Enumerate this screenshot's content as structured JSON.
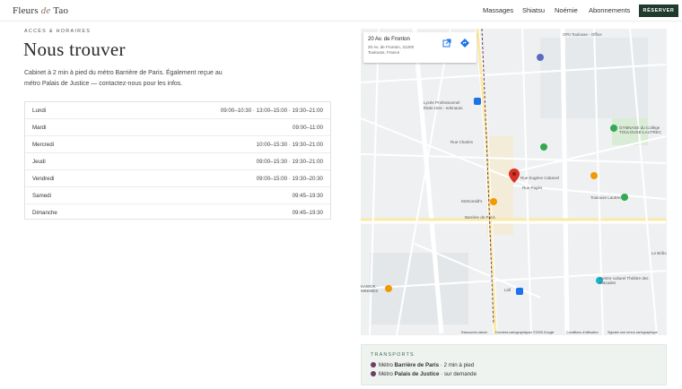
{
  "header": {
    "logo_part1": "Fleurs ",
    "logo_part2": "de",
    "logo_part3": " Tao",
    "nav": [
      "Massages",
      "Shiatsu",
      "Noémie",
      "Abonnements"
    ],
    "cta": "RÉSERVER"
  },
  "section": {
    "eyebrow": "ACCÈS & HORAIRES",
    "title": "Nous trouver",
    "intro": "Cabinet à 2 min à pied du métro Barrière de Paris. Également reçue au métro Palais de Justice — contactez-nous pour les infos."
  },
  "hours": [
    {
      "day": "Lundi",
      "time": "09:00–10:30 · 13:00–15:00 · 19:30–21:00"
    },
    {
      "day": "Mardi",
      "time": "09:00–11:00"
    },
    {
      "day": "Mercredi",
      "time": "10:00–15:30 · 19:30–21:00"
    },
    {
      "day": "Jeudi",
      "time": "09:00–15:30 · 19:30–21:00"
    },
    {
      "day": "Vendredi",
      "time": "09:00–15:00 · 19:30–20:30"
    },
    {
      "day": "Samedi",
      "time": "09:45–19:30"
    },
    {
      "day": "Dimanche",
      "time": "09:45–19:30"
    }
  ],
  "map": {
    "card_title": "20 Av. de Fronton",
    "card_address": "20 Av. de Fronton, 31200 Toulouse, France",
    "labels": {
      "ofii": "OFII Toulouse - Office",
      "lycee": "Lycée Professionnel",
      "lycee2": "Toulouse-Lautrec",
      "gymnase": "GYMNASE du Collège TOULOUSE-LAUTREC",
      "institut": "Institut Toulouse",
      "etats": "États-Unis - edenauto",
      "rue_charles": "Rue Charles",
      "rue_eugene": "Rue Eugène Cabanel",
      "rue_pages": "Rue Pagès",
      "mcdo": "McDonald's",
      "barriere": "Barrière de Paris",
      "toulouse_lautrec": "Toulouse Lautrec",
      "kawok": "KAWOK - MINIMES",
      "lidl": "Lidl",
      "centre": "Centre culturel Théâtre des Mazades",
      "brulo": "Le Brûlo",
      "rue_fronton": "Av. de Fronton",
      "rue_ferre": "Rue Pierre-Ferré",
      "rue_lardenne": "Rue de Lardenne",
      "bd_silvio": "Bd Silvio Trentin",
      "av_lacourtensourt": "Av. de Lacourtensourt"
    },
    "footer": [
      "Raccourcis clavier",
      "Données cartographiques ©2026 Google",
      "Conditions d'utilisation",
      "Signaler une erreur cartographique"
    ]
  },
  "transports": {
    "title": "TRANSPORTS",
    "lines": [
      {
        "prefix": "Métro ",
        "station": "Barrière de Paris",
        "suffix": " · 2 min à pied"
      },
      {
        "prefix": "Métro ",
        "station": "Palais de Justice",
        "suffix": " · sur demande"
      }
    ]
  },
  "colors": {
    "accent": "#1f3b2c",
    "metro": "#6b3f63",
    "pin": "#d93025"
  }
}
